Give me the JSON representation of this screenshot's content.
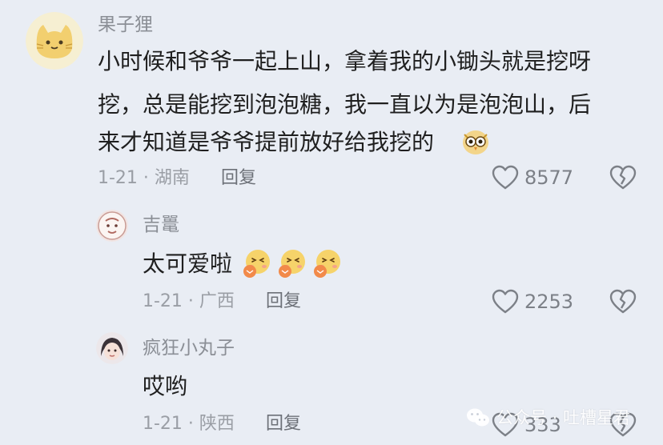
{
  "comments": [
    {
      "username": "果子狸",
      "lines": [
        "小时候和爷爷一起上山，拿着我的小锄头就是挖呀",
        "挖，总是能挖到泡泡糖，我一直以为是泡泡山，后",
        "来才知道是爷爷提前放好给我挖的"
      ],
      "date_location": "1-21 · 湖南",
      "reply_label": "回复",
      "likes": "8577"
    },
    {
      "username": "吉鼍",
      "text": "太可爱啦",
      "date_location": "1-21 · 广西",
      "reply_label": "回复",
      "likes": "2253"
    },
    {
      "username": "疯狂小丸子",
      "text": "哎哟",
      "date_location": "1-21 · 陕西",
      "reply_label": "回复",
      "likes": "333"
    }
  ],
  "watermark": {
    "text": "公众号 · 吐槽星君"
  },
  "icons": [
    "heart-icon",
    "broken-heart-icon",
    "blush-emoji-icon",
    "owl-emoji-icon",
    "wechat-icon"
  ],
  "colors": {
    "background": "#e9edf4",
    "username": "#8b8f96",
    "text": "#1f1f1f",
    "meta": "#9a9ea5"
  }
}
